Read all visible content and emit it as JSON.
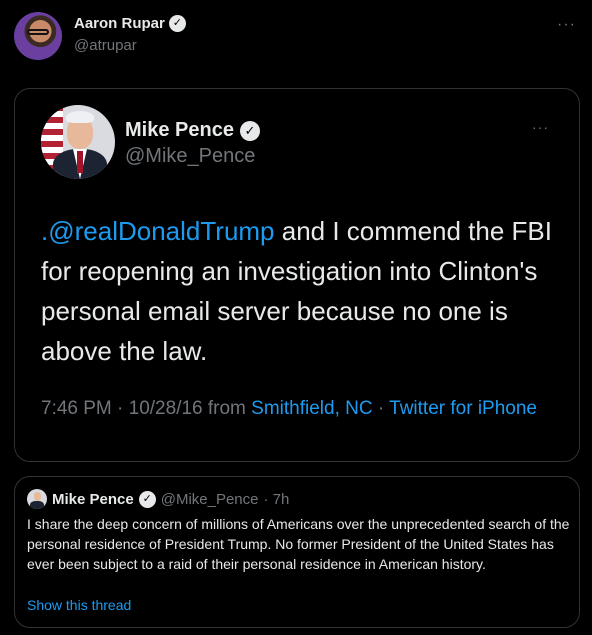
{
  "author": {
    "name": "Aaron Rupar",
    "handle": "@atrupar",
    "more_icon": "more-horizontal-icon"
  },
  "embedded_tweet": {
    "name": "Mike Pence",
    "handle": "@Mike_Pence",
    "mention": ".@realDonaldTrump",
    "text": " and I commend the FBI for reopening an investigation into Clinton's personal email server because no one is above the law.",
    "timestamp": "7:46 PM · 10/28/16 from ",
    "location": "Smithfield, NC",
    "separator": " · ",
    "source": "Twitter for iPhone"
  },
  "quoted_tweet": {
    "name": "Mike Pence",
    "handle": "@Mike_Pence",
    "time": "· 7h",
    "text": "I share the deep concern of millions of Americans over the unprecedented search of the personal residence of President Trump. No former President of the United States has ever been subject to a raid of their personal residence in American history.",
    "show_thread": "Show this thread"
  },
  "colors": {
    "link": "#1d9bf0",
    "background": "#000000",
    "muted": "#71767b",
    "border": "#2f3336"
  }
}
